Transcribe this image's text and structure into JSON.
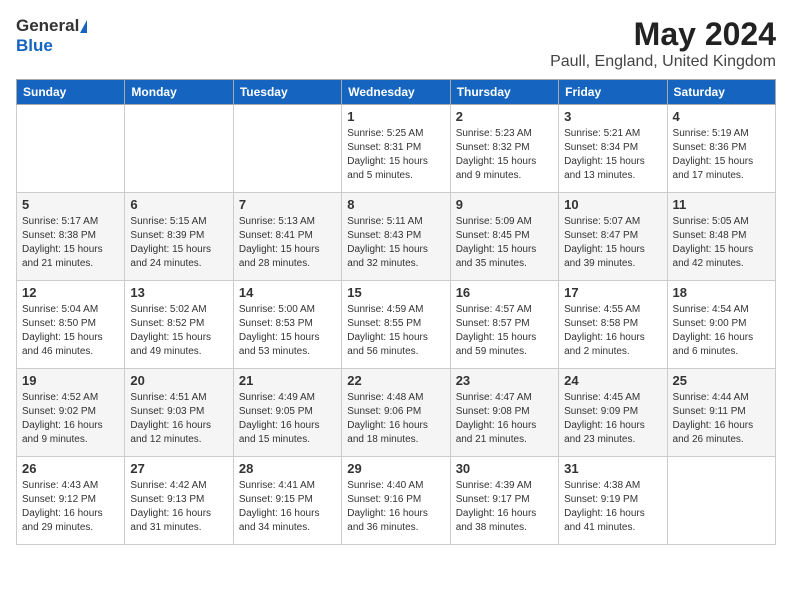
{
  "logo": {
    "general": "General",
    "blue": "Blue"
  },
  "title": {
    "month_year": "May 2024",
    "location": "Paull, England, United Kingdom"
  },
  "headers": [
    "Sunday",
    "Monday",
    "Tuesday",
    "Wednesday",
    "Thursday",
    "Friday",
    "Saturday"
  ],
  "weeks": [
    [
      {
        "day": "",
        "info": ""
      },
      {
        "day": "",
        "info": ""
      },
      {
        "day": "",
        "info": ""
      },
      {
        "day": "1",
        "info": "Sunrise: 5:25 AM\nSunset: 8:31 PM\nDaylight: 15 hours\nand 5 minutes."
      },
      {
        "day": "2",
        "info": "Sunrise: 5:23 AM\nSunset: 8:32 PM\nDaylight: 15 hours\nand 9 minutes."
      },
      {
        "day": "3",
        "info": "Sunrise: 5:21 AM\nSunset: 8:34 PM\nDaylight: 15 hours\nand 13 minutes."
      },
      {
        "day": "4",
        "info": "Sunrise: 5:19 AM\nSunset: 8:36 PM\nDaylight: 15 hours\nand 17 minutes."
      }
    ],
    [
      {
        "day": "5",
        "info": "Sunrise: 5:17 AM\nSunset: 8:38 PM\nDaylight: 15 hours\nand 21 minutes."
      },
      {
        "day": "6",
        "info": "Sunrise: 5:15 AM\nSunset: 8:39 PM\nDaylight: 15 hours\nand 24 minutes."
      },
      {
        "day": "7",
        "info": "Sunrise: 5:13 AM\nSunset: 8:41 PM\nDaylight: 15 hours\nand 28 minutes."
      },
      {
        "day": "8",
        "info": "Sunrise: 5:11 AM\nSunset: 8:43 PM\nDaylight: 15 hours\nand 32 minutes."
      },
      {
        "day": "9",
        "info": "Sunrise: 5:09 AM\nSunset: 8:45 PM\nDaylight: 15 hours\nand 35 minutes."
      },
      {
        "day": "10",
        "info": "Sunrise: 5:07 AM\nSunset: 8:47 PM\nDaylight: 15 hours\nand 39 minutes."
      },
      {
        "day": "11",
        "info": "Sunrise: 5:05 AM\nSunset: 8:48 PM\nDaylight: 15 hours\nand 42 minutes."
      }
    ],
    [
      {
        "day": "12",
        "info": "Sunrise: 5:04 AM\nSunset: 8:50 PM\nDaylight: 15 hours\nand 46 minutes."
      },
      {
        "day": "13",
        "info": "Sunrise: 5:02 AM\nSunset: 8:52 PM\nDaylight: 15 hours\nand 49 minutes."
      },
      {
        "day": "14",
        "info": "Sunrise: 5:00 AM\nSunset: 8:53 PM\nDaylight: 15 hours\nand 53 minutes."
      },
      {
        "day": "15",
        "info": "Sunrise: 4:59 AM\nSunset: 8:55 PM\nDaylight: 15 hours\nand 56 minutes."
      },
      {
        "day": "16",
        "info": "Sunrise: 4:57 AM\nSunset: 8:57 PM\nDaylight: 15 hours\nand 59 minutes."
      },
      {
        "day": "17",
        "info": "Sunrise: 4:55 AM\nSunset: 8:58 PM\nDaylight: 16 hours\nand 2 minutes."
      },
      {
        "day": "18",
        "info": "Sunrise: 4:54 AM\nSunset: 9:00 PM\nDaylight: 16 hours\nand 6 minutes."
      }
    ],
    [
      {
        "day": "19",
        "info": "Sunrise: 4:52 AM\nSunset: 9:02 PM\nDaylight: 16 hours\nand 9 minutes."
      },
      {
        "day": "20",
        "info": "Sunrise: 4:51 AM\nSunset: 9:03 PM\nDaylight: 16 hours\nand 12 minutes."
      },
      {
        "day": "21",
        "info": "Sunrise: 4:49 AM\nSunset: 9:05 PM\nDaylight: 16 hours\nand 15 minutes."
      },
      {
        "day": "22",
        "info": "Sunrise: 4:48 AM\nSunset: 9:06 PM\nDaylight: 16 hours\nand 18 minutes."
      },
      {
        "day": "23",
        "info": "Sunrise: 4:47 AM\nSunset: 9:08 PM\nDaylight: 16 hours\nand 21 minutes."
      },
      {
        "day": "24",
        "info": "Sunrise: 4:45 AM\nSunset: 9:09 PM\nDaylight: 16 hours\nand 23 minutes."
      },
      {
        "day": "25",
        "info": "Sunrise: 4:44 AM\nSunset: 9:11 PM\nDaylight: 16 hours\nand 26 minutes."
      }
    ],
    [
      {
        "day": "26",
        "info": "Sunrise: 4:43 AM\nSunset: 9:12 PM\nDaylight: 16 hours\nand 29 minutes."
      },
      {
        "day": "27",
        "info": "Sunrise: 4:42 AM\nSunset: 9:13 PM\nDaylight: 16 hours\nand 31 minutes."
      },
      {
        "day": "28",
        "info": "Sunrise: 4:41 AM\nSunset: 9:15 PM\nDaylight: 16 hours\nand 34 minutes."
      },
      {
        "day": "29",
        "info": "Sunrise: 4:40 AM\nSunset: 9:16 PM\nDaylight: 16 hours\nand 36 minutes."
      },
      {
        "day": "30",
        "info": "Sunrise: 4:39 AM\nSunset: 9:17 PM\nDaylight: 16 hours\nand 38 minutes."
      },
      {
        "day": "31",
        "info": "Sunrise: 4:38 AM\nSunset: 9:19 PM\nDaylight: 16 hours\nand 41 minutes."
      },
      {
        "day": "",
        "info": ""
      }
    ]
  ]
}
